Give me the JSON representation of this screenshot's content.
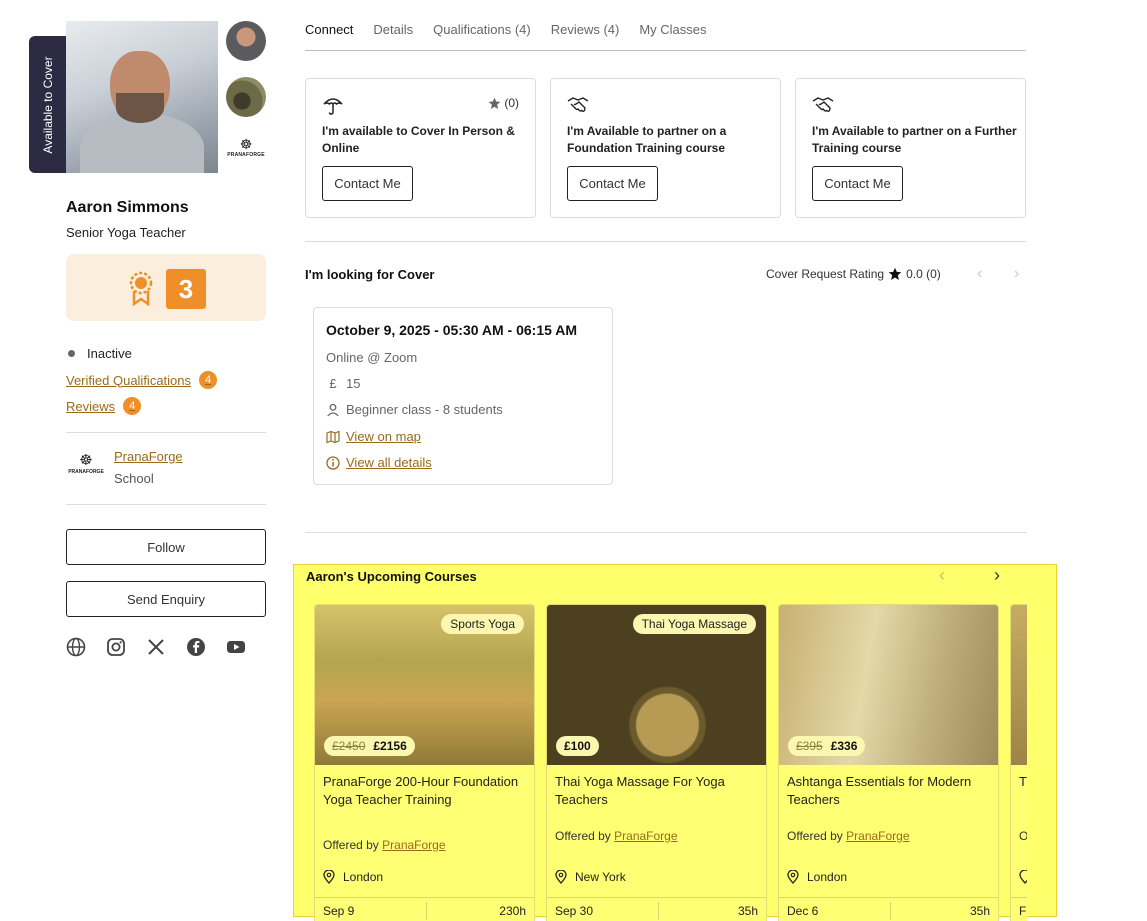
{
  "profile": {
    "availability_tab": "Available to Cover",
    "name": "Aaron Simmons",
    "role": "Senior Yoga Teacher",
    "level": "3",
    "status": "Inactive",
    "verified_qualifications_label": "Verified Qualifications",
    "verified_qualifications_count": "4",
    "reviews_label": "Reviews",
    "reviews_count": "4",
    "logo_text": "PRANAFORGE",
    "school": {
      "name": "PranaForge",
      "type": "School",
      "logo_text": "PRANAFORGE"
    },
    "follow_label": "Follow",
    "enquiry_label": "Send Enquiry",
    "social_icons": [
      "globe-icon",
      "instagram-icon",
      "x-icon",
      "facebook-icon",
      "youtube-icon"
    ]
  },
  "tabs": [
    {
      "label": "Connect"
    },
    {
      "label": "Details"
    },
    {
      "label": "Qualifications (4)"
    },
    {
      "label": "Reviews (4)"
    },
    {
      "label": "My Classes"
    }
  ],
  "connect_cards": [
    {
      "icon": "umbrella-icon",
      "rating": "(0)",
      "title": "I'm available to Cover In Person & Online",
      "button": "Contact Me"
    },
    {
      "icon": "handshake-icon",
      "title": "I'm Available to partner on a Foundation Training course",
      "button": "Contact Me"
    },
    {
      "icon": "handshake-icon",
      "title": "I'm Available to partner on a Further Training course",
      "button": "Contact Me"
    }
  ],
  "cover": {
    "title": "I'm looking for Cover",
    "rating_label": "Cover Request Rating",
    "rating_value": "0.0 (0)",
    "request": {
      "date": "October 9, 2025 - 05:30 AM - 06:15 AM",
      "location": "Online @ Zoom",
      "currency": "£",
      "price": "15",
      "class_info": "Beginner class - 8 students",
      "map_link": "View on map",
      "details_link": "View all details"
    }
  },
  "courses": {
    "title": "Aaron's Upcoming Courses",
    "items": [
      {
        "category": "Sports Yoga",
        "old_price": "£2450",
        "price": "£2156",
        "title": "PranaForge 200-Hour Foundation Yoga Teacher Training",
        "offered_by": "Offered by",
        "provider": "PranaForge",
        "location": "London",
        "date": "Sep 9",
        "hours": "230h"
      },
      {
        "category": "Thai Yoga Massage",
        "old_price": "",
        "price": "£100",
        "title": "Thai Yoga Massage For Yoga Teachers",
        "offered_by": "Offered by",
        "provider": "PranaForge",
        "location": "New York",
        "date": "Sep 30",
        "hours": "35h"
      },
      {
        "category": "",
        "old_price": "£395",
        "price": "£336",
        "title": "Ashtanga Essentials for Modern Teachers",
        "offered_by": "Offered by",
        "provider": "PranaForge",
        "location": "London",
        "date": "Dec 6",
        "hours": "35h"
      },
      {
        "category": "",
        "old_price": "",
        "price": "",
        "title": "T In",
        "offered_by": "O",
        "provider": "",
        "location": "",
        "date": "F",
        "hours": ""
      }
    ]
  },
  "colors": {
    "accent": "#ee8f2a",
    "link": "#9a6a1c",
    "dark_tab": "#2d2a44",
    "highlight": "#ffff6b"
  }
}
